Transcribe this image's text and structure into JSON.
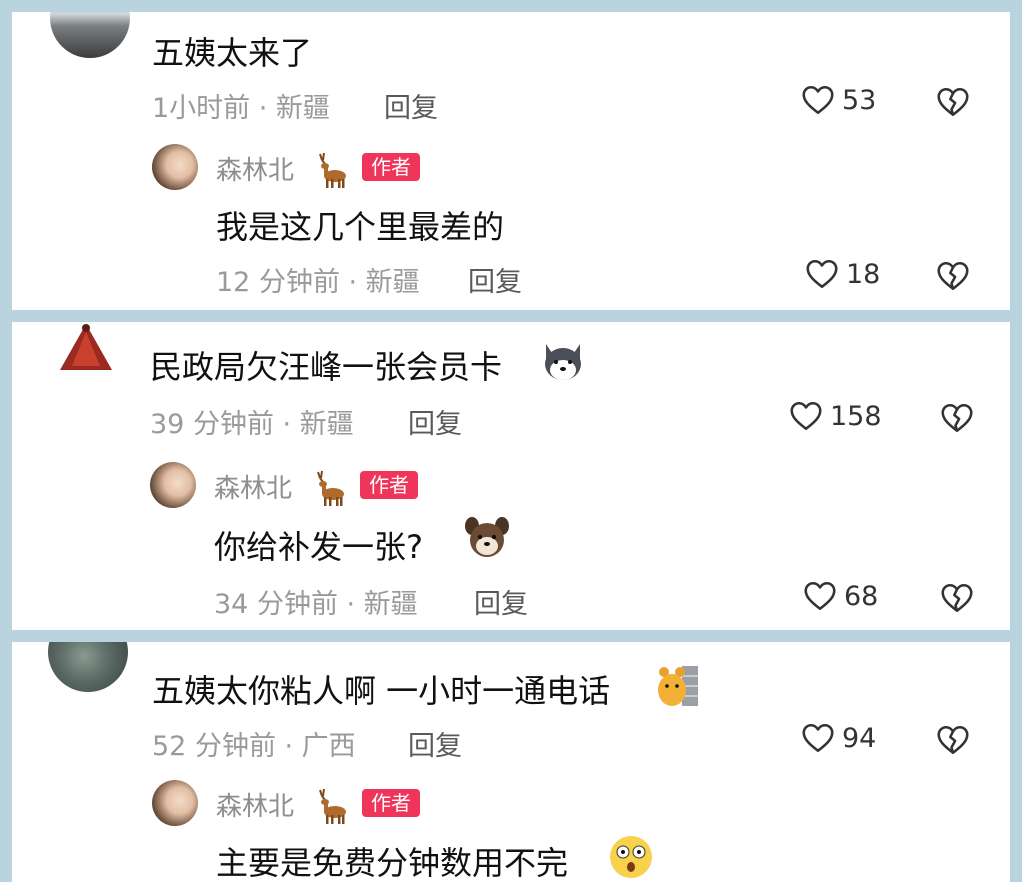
{
  "threads": [
    {
      "comment": {
        "text": "五姨太来了",
        "meta": "1小时前 · 新疆",
        "reply": "回复",
        "likes": "53"
      },
      "author_reply": {
        "username": "森林北",
        "badge": "作者",
        "text": "我是这几个里最差的",
        "meta": "12 分钟前 · 新疆",
        "reply": "回复",
        "likes": "18"
      }
    },
    {
      "comment": {
        "text": "民政局欠汪峰一张会员卡",
        "meta": "39 分钟前 · 新疆",
        "reply": "回复",
        "likes": "158"
      },
      "author_reply": {
        "username": "森林北",
        "badge": "作者",
        "text": "你给补发一张?",
        "meta": "34 分钟前 · 新疆",
        "reply": "回复",
        "likes": "68"
      }
    },
    {
      "comment": {
        "text": "五姨太你粘人啊 一小时一通电话",
        "meta": "52 分钟前 · 广西",
        "reply": "回复",
        "likes": "94"
      },
      "author_reply": {
        "username": "森林北",
        "badge": "作者",
        "text": "主要是免费分钟数用不完"
      }
    }
  ],
  "icons": {
    "like": "heart-outline-icon",
    "dislike": "broken-heart-icon",
    "deer": "deer-emoji",
    "husky": "husky-emoji",
    "dog": "dog-emoji",
    "bear_wall": "bear-peeking-emoji",
    "shocked": "shocked-face-emoji"
  },
  "colors": {
    "badge": "#f0355a",
    "meta": "#9a9a9a",
    "background": "#b9d4df"
  }
}
